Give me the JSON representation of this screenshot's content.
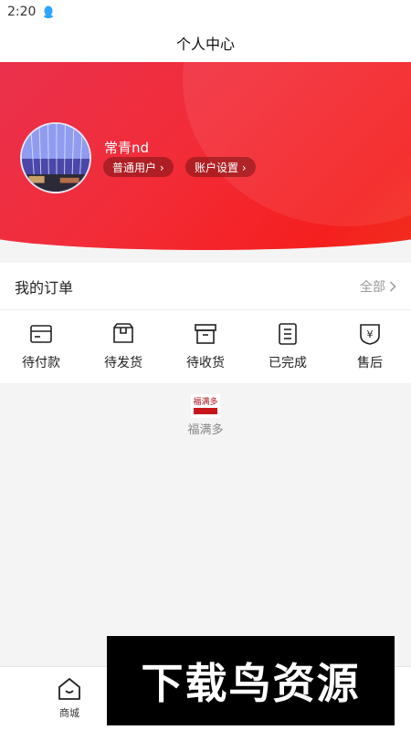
{
  "status": {
    "time": "2:20",
    "icon": "qq-penguin-icon"
  },
  "page": {
    "title": "个人中心"
  },
  "profile": {
    "username": "常青nd",
    "user_type_label": "普通用户 ›",
    "account_settings_label": "账户设置 ›"
  },
  "orders": {
    "title": "我的订单",
    "all_label": "全部",
    "items": [
      {
        "label": "待付款",
        "icon": "wallet-icon"
      },
      {
        "label": "待发货",
        "icon": "package-icon"
      },
      {
        "label": "待收货",
        "icon": "box-icon"
      },
      {
        "label": "已完成",
        "icon": "list-icon"
      },
      {
        "label": "售后",
        "icon": "yuan-shield-icon"
      }
    ]
  },
  "brand": {
    "logo_text": "福满多",
    "name": "福满多"
  },
  "tabbar": {
    "home_label": "商城"
  },
  "watermark": {
    "text": "下载鸟资源"
  },
  "colors": {
    "accent": "#f22c38",
    "background": "#f4f4f4"
  }
}
